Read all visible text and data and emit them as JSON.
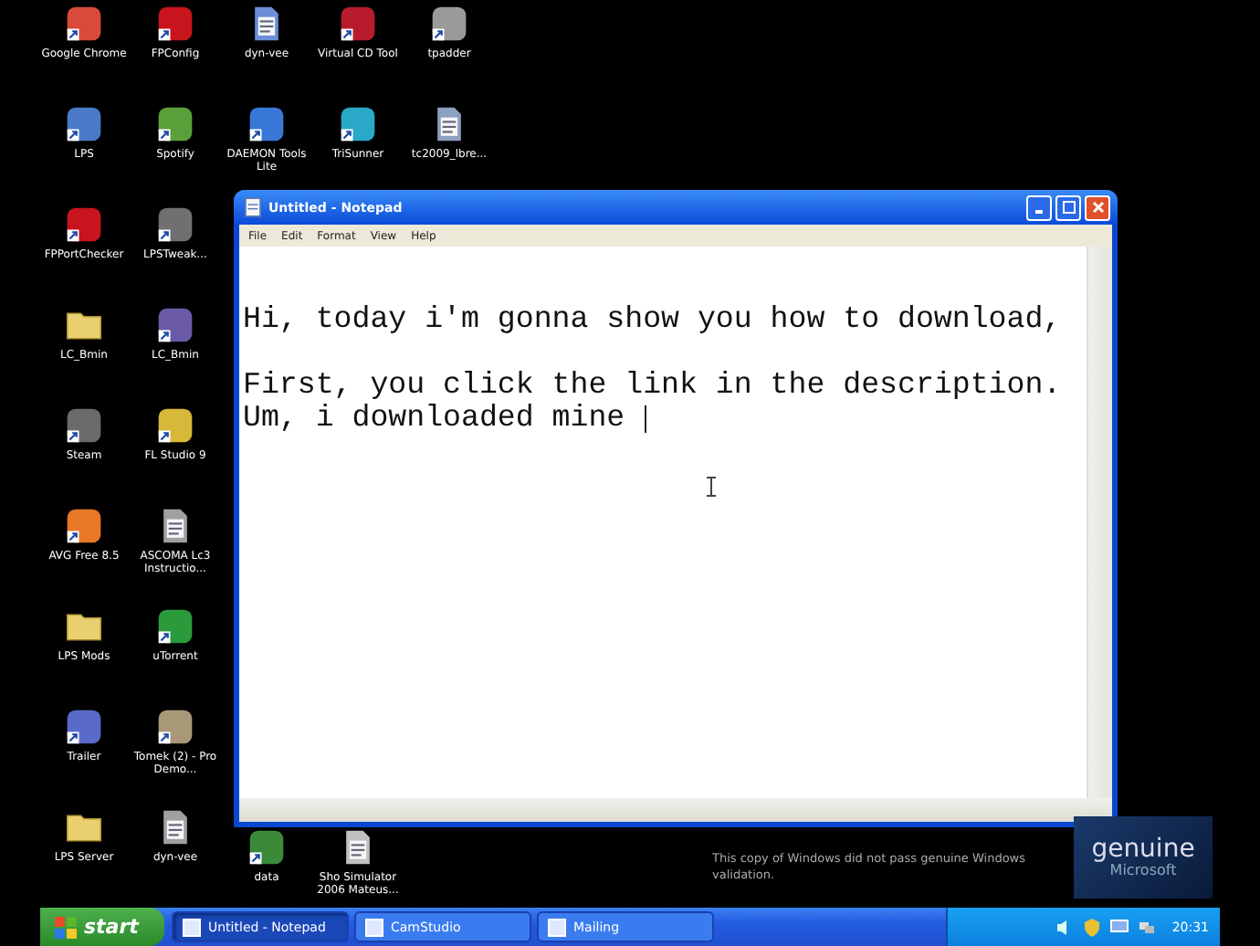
{
  "desktop": {
    "top_icons": [
      {
        "label": "Google Chrome",
        "kind": "app",
        "color": "#d84a3a"
      },
      {
        "label": "FPConfig",
        "kind": "app",
        "color": "#c8141c"
      },
      {
        "label": "dyn-vee",
        "kind": "document",
        "color": "#6c8ed8"
      },
      {
        "label": "Virtual CD Tool",
        "kind": "app",
        "color": "#b81c2c"
      },
      {
        "label": "tpadder",
        "kind": "app",
        "color": "#9a9a9a"
      },
      {
        "label": "LPS",
        "kind": "app",
        "color": "#4a7ac8"
      },
      {
        "label": "Spotify",
        "kind": "app",
        "color": "#5aa03a"
      },
      {
        "label": "DAEMON Tools Lite",
        "kind": "app",
        "color": "#3a78d8"
      },
      {
        "label": "TriSunner",
        "kind": "app",
        "color": "#2aa8c8"
      },
      {
        "label": "tc2009_lbre...",
        "kind": "document",
        "color": "#8ca0c0"
      }
    ],
    "left_icons": [
      {
        "label": "FPPortChecker",
        "kind": "app",
        "color": "#c8141c"
      },
      {
        "label": "LPSTweak...",
        "kind": "app",
        "color": "#707070"
      },
      {
        "label": "LC_Bmin",
        "kind": "folder",
        "color": "#e8d070"
      },
      {
        "label": "LC_Bmin",
        "kind": "app",
        "color": "#6a5aa8"
      },
      {
        "label": "Steam",
        "kind": "app",
        "color": "#6a6a6a"
      },
      {
        "label": "FL Studio 9",
        "kind": "app",
        "color": "#d8b838"
      },
      {
        "label": "AVG Free 8.5",
        "kind": "app",
        "color": "#e87828"
      },
      {
        "label": "ASCOMA Lc3 Instructio...",
        "kind": "document",
        "color": "#a0a0a0"
      },
      {
        "label": "LPS Mods",
        "kind": "folder",
        "color": "#e8d070"
      },
      {
        "label": "uTorrent",
        "kind": "app",
        "color": "#2a9a3a"
      },
      {
        "label": "Trailer",
        "kind": "app",
        "color": "#5a6ac8"
      },
      {
        "label": "Tomek (2) - Pro Demo...",
        "kind": "app",
        "color": "#a89878"
      },
      {
        "label": "LPS Server",
        "kind": "folder",
        "color": "#e8d070"
      },
      {
        "label": "dyn-vee",
        "kind": "document",
        "color": "#a0a0a0"
      }
    ],
    "bottom_icons": [
      {
        "label": "data",
        "kind": "app",
        "color": "#3a8a3a"
      },
      {
        "label": "Sho Simulator 2006 Mateus...",
        "kind": "document",
        "color": "#c0c0c0"
      }
    ]
  },
  "notepad": {
    "title": "Untitled - Notepad",
    "menu": [
      "File",
      "Edit",
      "Format",
      "View",
      "Help"
    ],
    "paragraphs": [
      {
        "lines": [
          "Hi, today i'm gonna show you how to download,"
        ]
      },
      {
        "lines": [
          "First, you click the link in the description.",
          "Um, i downloaded mine"
        ]
      }
    ]
  },
  "genuine_notice": {
    "message": "This copy of Windows did not pass genuine Windows validation.",
    "badge_title": "genuine",
    "badge_brand": "Microsoft"
  },
  "taskbar": {
    "start": "start",
    "tasks": [
      {
        "label": "Untitled - Notepad",
        "selected": true
      },
      {
        "label": "CamStudio",
        "selected": false
      },
      {
        "label": "Mailing",
        "selected": false
      }
    ],
    "clock": "20:31"
  }
}
